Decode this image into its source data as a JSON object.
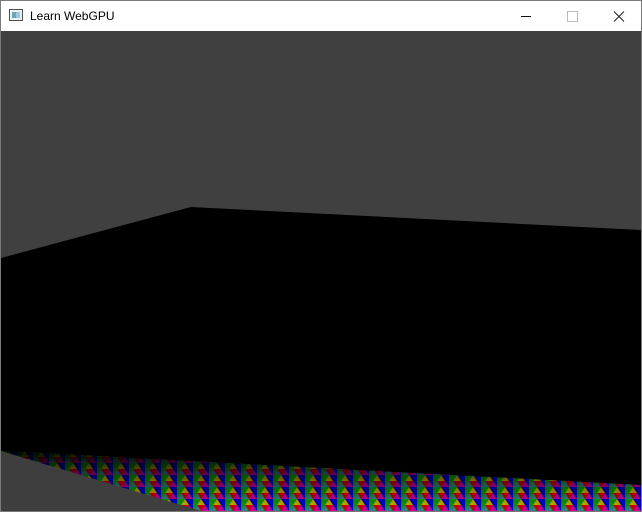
{
  "window": {
    "title": "Learn WebGPU",
    "icons": {
      "app": "application-window-icon",
      "minimize": "minimize-icon",
      "maximize": "maximize-icon",
      "close": "close-icon"
    }
  },
  "scene": {
    "background": "#404040",
    "wall": "#000000",
    "floor_colors": [
      "#d00000",
      "#00a000",
      "#0000cc",
      "#cccc00",
      "#c000c0",
      "#00b0b0",
      "#ffffff"
    ]
  }
}
